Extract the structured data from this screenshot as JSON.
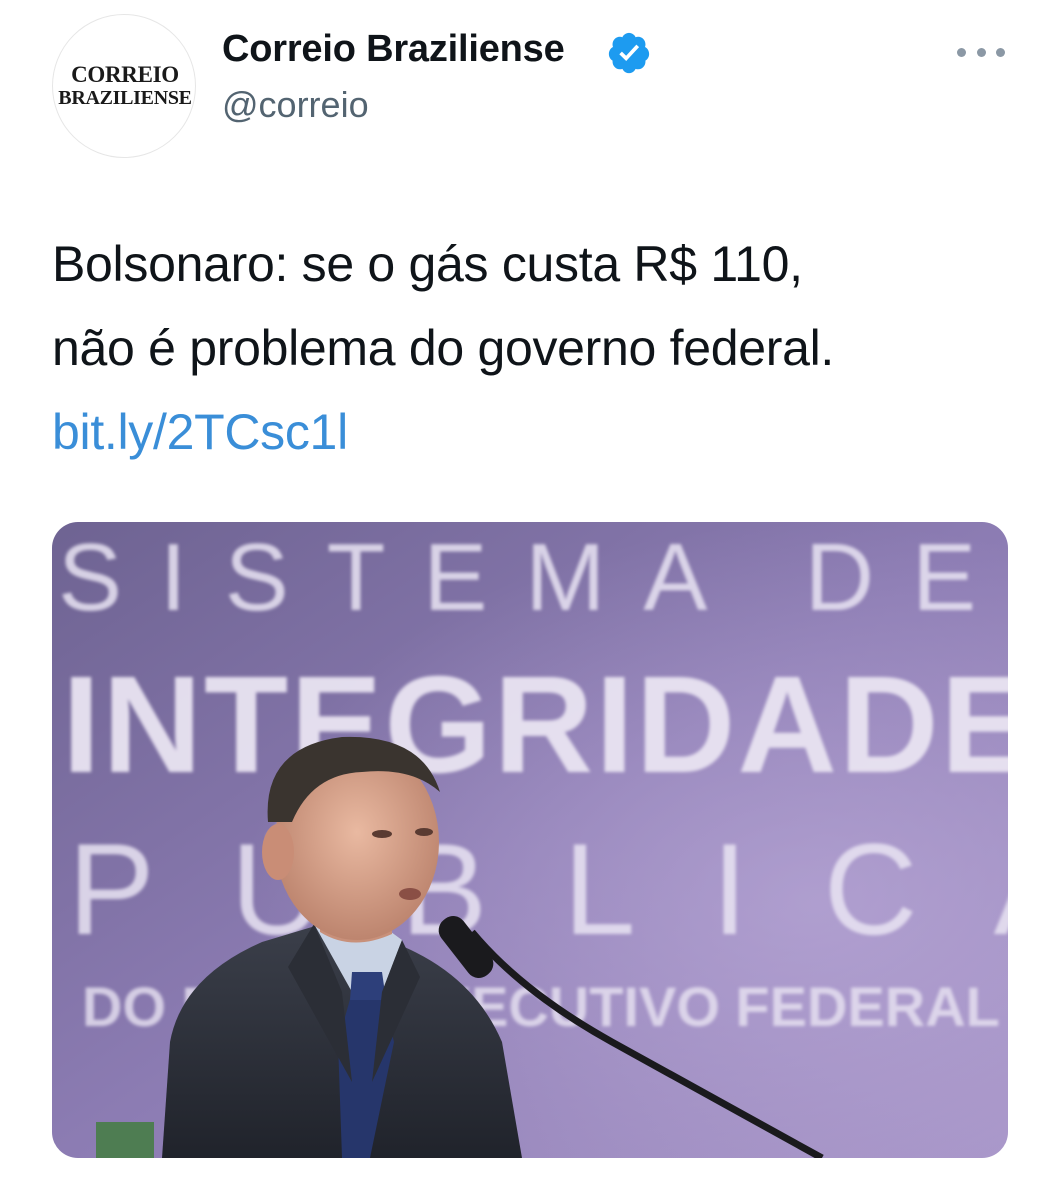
{
  "account": {
    "display_name": "Correio Braziliense",
    "handle": "@correio",
    "verified_icon": "verified-badge-icon",
    "avatar_logo": [
      "CORREIO",
      "BRAZILIENSE"
    ]
  },
  "tweet": {
    "text_lines": [
      "Bolsonaro: se o gás custa R$ 110,",
      "não é problema do governo federal."
    ],
    "link": "bit.ly/2TCsc1l"
  },
  "photo": {
    "banner_lines": [
      "SISTEMA DE",
      "INTEGRIDADE",
      "PÚBLICA",
      "DO PODER EXECUTIVO FEDERAL"
    ]
  },
  "colors": {
    "link": "#3a8ed8",
    "verified": "#1d9bf0",
    "handle": "#536471",
    "banner": "#8a7bb0"
  }
}
